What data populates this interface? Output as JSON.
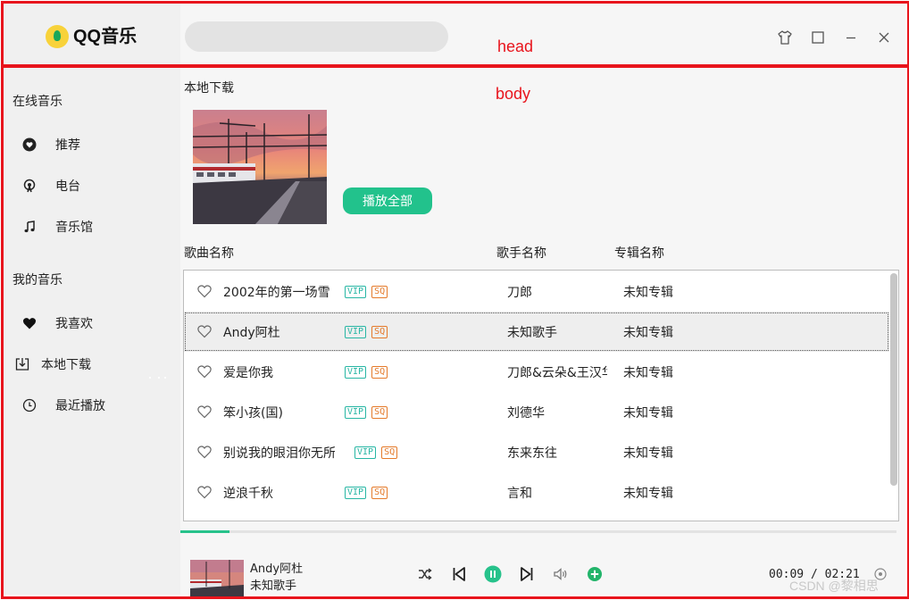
{
  "header": {
    "logo_text": "QQ音乐",
    "search_placeholder": "",
    "annotation_label": "head"
  },
  "body_annotation_label": "body",
  "sidebar": {
    "online_title": "在线音乐",
    "online_items": [
      {
        "label": "推荐",
        "icon": "heart-circle-icon"
      },
      {
        "label": "电台",
        "icon": "radio-icon"
      },
      {
        "label": "音乐馆",
        "icon": "music-note-icon"
      }
    ],
    "my_title": "我的音乐",
    "my_items": [
      {
        "label": "我喜欢",
        "icon": "heart-icon"
      },
      {
        "label": "本地下载",
        "icon": "download-icon"
      },
      {
        "label": "最近播放",
        "icon": "clock-icon"
      }
    ]
  },
  "main": {
    "section_title": "本地下载",
    "play_all_label": "播放全部",
    "columns": {
      "song": "歌曲名称",
      "artist": "歌手名称",
      "album": "专辑名称"
    },
    "tags": {
      "vip": "VIP",
      "sq": "SQ"
    },
    "songs": [
      {
        "name": "2002年的第一场雪",
        "artist": "刀郎",
        "album": "未知专辑"
      },
      {
        "name": "Andy阿杜",
        "artist": "未知歌手",
        "album": "未知专辑"
      },
      {
        "name": "爱是你我",
        "artist": "刀郎&云朵&王汉华",
        "album": "未知专辑"
      },
      {
        "name": "笨小孩(国)",
        "artist": "刘德华",
        "album": "未知专辑"
      },
      {
        "name": "别说我的眼泪你无所谓",
        "artist": "东来东往",
        "album": "未知专辑"
      },
      {
        "name": "逆浪千秋",
        "artist": "言和",
        "album": "未知专辑"
      }
    ],
    "selected_index": 1
  },
  "player": {
    "title": "Andy阿杜",
    "artist": "未知歌手",
    "current_time": "00:09",
    "separator": "/",
    "total_time": "02:21",
    "progress": 0.068
  },
  "watermark": "CSDN @黎相思",
  "colors": {
    "accent": "#22c28c",
    "vip_tag": "#27b6a4",
    "sq_tag": "#e47a2a",
    "annotation_red": "#e8141c"
  }
}
